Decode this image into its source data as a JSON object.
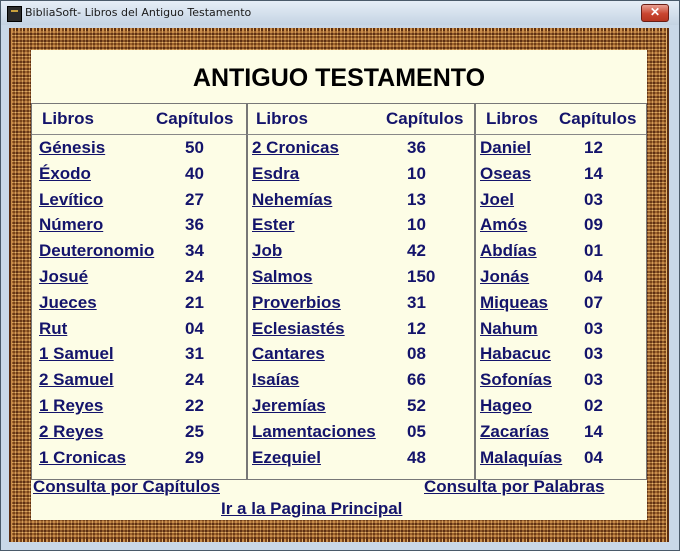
{
  "window": {
    "title": "BibliaSoft- Libros del Antiguo Testamento",
    "close_label": "✕"
  },
  "page": {
    "heading": "ANTIGUO TESTAMENTO"
  },
  "columns": [
    {
      "header_books": "Libros",
      "header_chapters": "Capítulos",
      "rows": [
        {
          "book": "Génesis",
          "chapters": "50"
        },
        {
          "book": "Éxodo",
          "chapters": "40"
        },
        {
          "book": "Levítico",
          "chapters": "27"
        },
        {
          "book": "Número",
          "chapters": "36"
        },
        {
          "book": "Deuteronomio",
          "chapters": "34"
        },
        {
          "book": "Josué",
          "chapters": "24"
        },
        {
          "book": "Jueces",
          "chapters": "21"
        },
        {
          "book": "Rut",
          "chapters": "04"
        },
        {
          "book": "1 Samuel",
          "chapters": "31"
        },
        {
          "book": "2 Samuel",
          "chapters": "24"
        },
        {
          "book": "1 Reyes",
          "chapters": "22"
        },
        {
          "book": "2 Reyes",
          "chapters": "25"
        },
        {
          "book": "1 Cronicas",
          "chapters": "29"
        }
      ]
    },
    {
      "header_books": "Libros",
      "header_chapters": "Capítulos",
      "rows": [
        {
          "book": "2 Cronicas",
          "chapters": "36"
        },
        {
          "book": "Esdra",
          "chapters": "10"
        },
        {
          "book": "Nehemías",
          "chapters": "13"
        },
        {
          "book": "Ester",
          "chapters": "10"
        },
        {
          "book": "Job",
          "chapters": "42"
        },
        {
          "book": "Salmos",
          "chapters": "150"
        },
        {
          "book": "Proverbios",
          "chapters": "31"
        },
        {
          "book": "Eclesiastés",
          "chapters": "12"
        },
        {
          "book": "Cantares",
          "chapters": "08"
        },
        {
          "book": "Isaías",
          "chapters": "66"
        },
        {
          "book": "Jeremías",
          "chapters": "52"
        },
        {
          "book": "Lamentaciones",
          "chapters": "05"
        },
        {
          "book": "Ezequiel",
          "chapters": "48"
        }
      ]
    },
    {
      "header_books": "Libros",
      "header_chapters": "Capítulos",
      "rows": [
        {
          "book": "Daniel",
          "chapters": "12"
        },
        {
          "book": "Oseas",
          "chapters": "14"
        },
        {
          "book": "Joel",
          "chapters": "03"
        },
        {
          "book": "Amós",
          "chapters": "09"
        },
        {
          "book": "Abdías",
          "chapters": "01"
        },
        {
          "book": "Jonás",
          "chapters": "04"
        },
        {
          "book": "Miqueas",
          "chapters": "07"
        },
        {
          "book": "Nahum",
          "chapters": "03"
        },
        {
          "book": "Habacuc",
          "chapters": "03"
        },
        {
          "book": "Sofonías",
          "chapters": "03"
        },
        {
          "book": "Hageo",
          "chapters": "02"
        },
        {
          "book": "Zacarías",
          "chapters": "14"
        },
        {
          "book": "Malaquías",
          "chapters": "04"
        }
      ]
    }
  ],
  "footer": {
    "consult_chapters": "Consulta por  Capítulos",
    "consult_words": "Consulta por Palabras",
    "main_page": "Ir a la Pagina Principal "
  },
  "colors": {
    "link": "#14146b",
    "background": "#fdfde6"
  }
}
